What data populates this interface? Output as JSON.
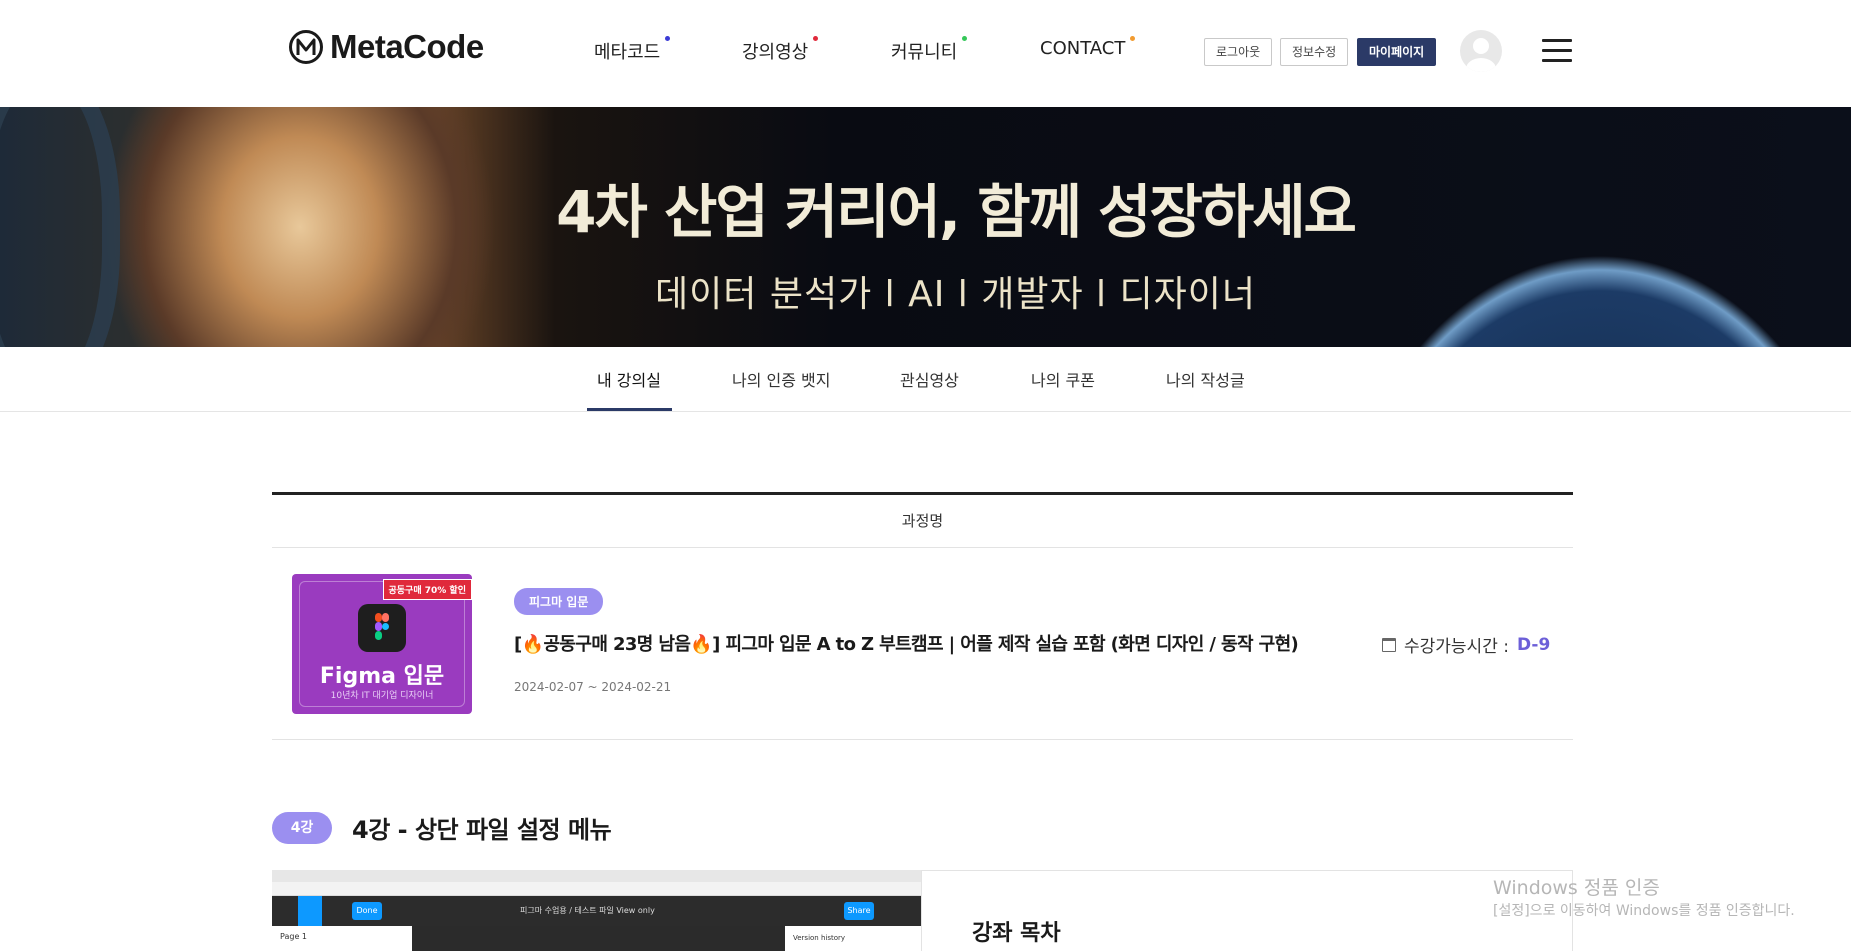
{
  "header": {
    "logo_text": "MetaCode",
    "nav": [
      {
        "label": "메타코드",
        "dot_color": "#3b3bd6"
      },
      {
        "label": "강의영상",
        "dot_color": "#e0293b"
      },
      {
        "label": "커뮤니티",
        "dot_color": "#35c759"
      },
      {
        "label": "CONTACT",
        "dot_color": "#f29b30"
      }
    ],
    "buttons": {
      "logout": "로그아웃",
      "edit_info": "정보수정",
      "mypage": "마이페이지"
    }
  },
  "banner": {
    "title": "4차 산업 커리어, 함께 성장하세요",
    "subtitle": "데이터 분석가 l  AI  l 개발자  l  디자이너"
  },
  "tabs": [
    {
      "label": "내 강의실",
      "active": true
    },
    {
      "label": "나의 인증 뱃지",
      "active": false
    },
    {
      "label": "관심영상",
      "active": false
    },
    {
      "label": "나의 쿠폰",
      "active": false
    },
    {
      "label": "나의 작성글",
      "active": false
    }
  ],
  "course_table": {
    "header": "과정명",
    "course": {
      "thumb_badge": "공동구매 70% 할인",
      "thumb_title": "Figma 입문",
      "thumb_sub": "10년차 IT 대기업 디자이너",
      "tag": "피그마 입문",
      "title": "[🔥공동구매 23명 남음🔥] 피그마 입문 A to Z 부트캠프 | 어플 제작 실습 포함 (화면 디자인 / 동작 구현)",
      "date_range": "2024-02-07 ~ 2024-02-21",
      "available_label": "수강가능시간 :",
      "available_value": "D-9"
    }
  },
  "lecture": {
    "badge": "4강",
    "title": "4강 - 상단 파일 설정 메뉴",
    "video": {
      "done_label": "Done",
      "breadcrumb": "피그마 수업용  /  테스트 파일     View only",
      "share_label": "Share",
      "page_label": "Page 1",
      "panel_label": "Version history"
    },
    "toc_title": "강좌 목차"
  },
  "watermark": {
    "line1": "Windows 정품 인증",
    "line2": "[설정]으로 이동하여 Windows를 정품 인증합니다."
  }
}
